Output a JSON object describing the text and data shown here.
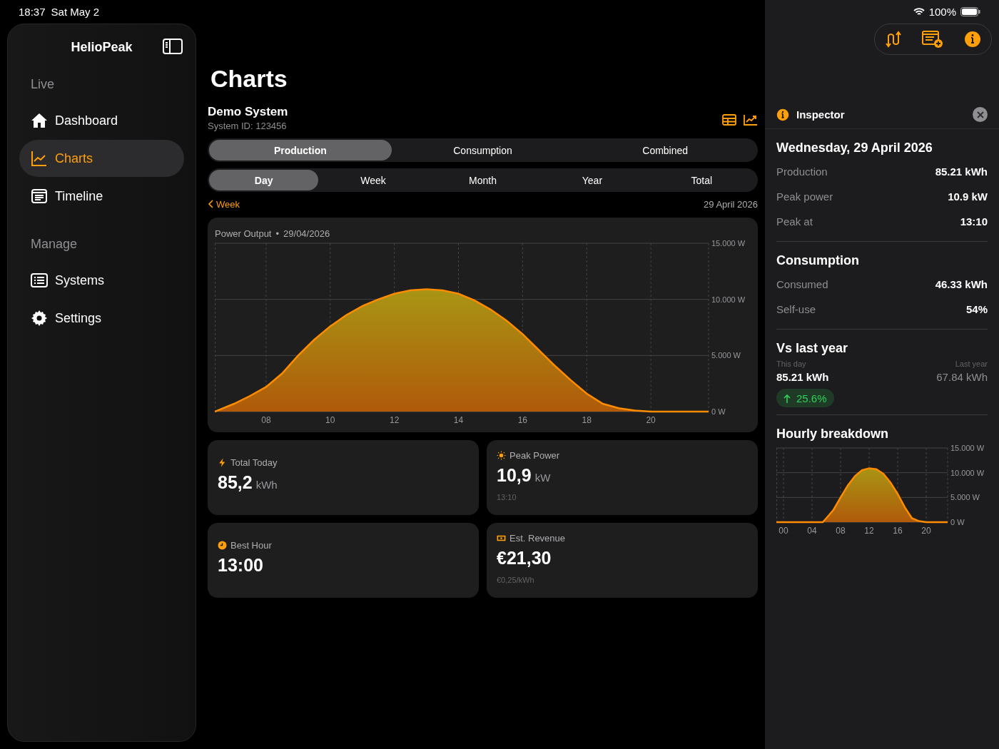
{
  "status_bar": {
    "time": "18:37",
    "date": "Sat May 2",
    "battery": "100%"
  },
  "sidebar": {
    "title": "HelioPeak",
    "sections": [
      {
        "title": "Live",
        "items": [
          {
            "label": "Dashboard",
            "selected": false
          },
          {
            "label": "Charts",
            "selected": true
          },
          {
            "label": "Timeline",
            "selected": false
          }
        ]
      },
      {
        "title": "Manage",
        "items": [
          {
            "label": "Systems",
            "selected": false
          },
          {
            "label": "Settings",
            "selected": false
          }
        ]
      }
    ]
  },
  "main": {
    "title": "Charts",
    "system_name": "Demo System",
    "system_id": "System ID: 123456",
    "metric_tabs": [
      {
        "label": "Production",
        "selected": true
      },
      {
        "label": "Consumption",
        "selected": false
      },
      {
        "label": "Combined",
        "selected": false
      }
    ],
    "period_tabs": [
      {
        "label": "Day",
        "selected": true
      },
      {
        "label": "Week",
        "selected": false
      },
      {
        "label": "Month",
        "selected": false
      },
      {
        "label": "Year",
        "selected": false
      },
      {
        "label": "Total",
        "selected": false
      }
    ],
    "back_link": "Week",
    "date": "29 April 2026",
    "chart": {
      "title": "Power Output",
      "separator": "•",
      "date": "29/04/2026",
      "chart_data": {
        "type": "area",
        "x": [
          6.4,
          7,
          7.5,
          8,
          8.5,
          9,
          9.5,
          10,
          10.5,
          11,
          11.5,
          12,
          12.5,
          13,
          13.5,
          14,
          14.5,
          15,
          15.5,
          16,
          16.5,
          17,
          17.5,
          18,
          18.5,
          19,
          19.5,
          20,
          20.5,
          21,
          21.8
        ],
        "series": [
          {
            "color": "#ff8c00",
            "values": [
              0,
              0.7,
              1.4,
              2.2,
              3.4,
              5,
              6.4,
              7.6,
              8.6,
              9.4,
              10,
              10.5,
              10.8,
              10.9,
              10.8,
              10.5,
              9.9,
              9.1,
              8.1,
              6.9,
              5.5,
              4.1,
              2.8,
              1.6,
              0.7,
              0.3,
              0.1,
              0,
              0,
              0,
              0
            ]
          }
        ],
        "xlim": [
          6.4,
          21.8
        ],
        "ylim": [
          0,
          15
        ],
        "grid": true,
        "xticks": [
          {
            "value": 8,
            "label": "08"
          },
          {
            "value": 10,
            "label": "10"
          },
          {
            "value": 12,
            "label": "12"
          },
          {
            "value": 14,
            "label": "14"
          },
          {
            "value": 16,
            "label": "16"
          },
          {
            "value": 18,
            "label": "18"
          },
          {
            "value": 20,
            "label": "20"
          }
        ],
        "yticks": [
          {
            "value": 0,
            "label": "0 W"
          },
          {
            "value": 5,
            "label": "5.000 W"
          },
          {
            "value": 10,
            "label": "10.000 W"
          },
          {
            "value": 15,
            "label": "15.000 W"
          }
        ]
      }
    },
    "stats": [
      {
        "label": "Total Today",
        "value": "85,2",
        "unit": "kWh"
      },
      {
        "label": "Peak Power",
        "value": "10,9",
        "unit": "kW",
        "note": "13:10"
      },
      {
        "label": "Best Hour",
        "value": "13:00"
      },
      {
        "label": "Est. Revenue",
        "value": "€21,30",
        "note": "€0,25/kWh"
      }
    ]
  },
  "inspector": {
    "title": "Inspector",
    "date": "Wednesday, 29 April 2026",
    "rows": [
      {
        "label": "Production",
        "value": "85.21 kWh"
      },
      {
        "label": "Peak power",
        "value": "10.9 kW"
      },
      {
        "label": "Peak at",
        "value": "13:10"
      }
    ],
    "consumption": {
      "title": "Consumption",
      "rows": [
        {
          "label": "Consumed",
          "value": "46.33 kWh"
        },
        {
          "label": "Self-use",
          "value": "54%"
        }
      ]
    },
    "comparison": {
      "title": "Vs last year",
      "this_label": "This day",
      "this_value": "85.21 kWh",
      "last_label": "Last year",
      "last_value": "67.84 kWh",
      "change": "25.6%"
    },
    "hourly": {
      "title": "Hourly breakdown",
      "chart_data": {
        "type": "area",
        "x": [
          -1,
          0,
          1,
          2,
          3,
          4,
          5,
          5.5,
          6,
          7,
          8,
          9,
          10,
          11,
          12,
          13,
          14,
          15,
          16,
          17,
          18,
          19,
          20,
          21,
          22,
          23
        ],
        "series": [
          {
            "color": "#ff8c00",
            "values": [
              0,
              0,
              0,
              0,
              0,
              0,
              0,
              0,
              0.8,
              2.5,
              5,
              7.4,
              9.3,
              10.5,
              10.9,
              10.7,
              9.8,
              8,
              5.7,
              3,
              0.8,
              0.2,
              0,
              0,
              0,
              0
            ]
          }
        ],
        "xlim": [
          -1,
          23
        ],
        "ylim": [
          0,
          15
        ],
        "grid": true,
        "xticks": [
          {
            "value": 0,
            "label": "00"
          },
          {
            "value": 4,
            "label": "04"
          },
          {
            "value": 8,
            "label": "08"
          },
          {
            "value": 12,
            "label": "12"
          },
          {
            "value": 16,
            "label": "16"
          },
          {
            "value": 20,
            "label": "20"
          }
        ],
        "yticks": [
          {
            "value": 0,
            "label": "0 W"
          },
          {
            "value": 5,
            "label": "5.000 W"
          },
          {
            "value": 10,
            "label": "10.000 W"
          },
          {
            "value": 15,
            "label": "15.000 W"
          }
        ]
      }
    }
  }
}
